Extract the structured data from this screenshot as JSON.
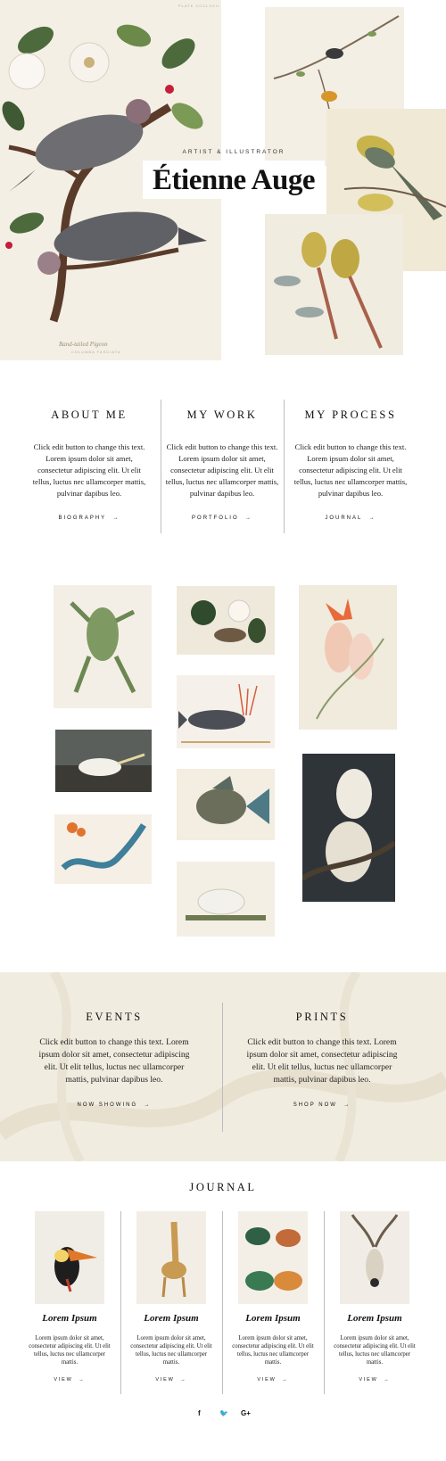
{
  "hero": {
    "kicker": "ARTIST & ILLUSTRATOR",
    "title": "Étienne Auge",
    "plate_corner_label": "PLATE CCCLXVII",
    "plate_caption": "Band-tailed Pigeon",
    "plate_credit_label": "COLUMBA FASCIATA"
  },
  "about": {
    "columns": [
      {
        "heading": "ABOUT ME",
        "text": "Click edit button to change this text. Lorem ipsum dolor sit amet, consectetur adipiscing elit. Ut elit tellus, luctus nec ullamcorper mattis, pulvinar dapibus leo.",
        "link": "BIOGRAPHY",
        "arrow": "→"
      },
      {
        "heading": "MY WORK",
        "text": "Click edit button to change this text. Lorem ipsum dolor sit amet, consectetur adipiscing elit. Ut elit tellus, luctus nec ullamcorper mattis, pulvinar dapibus leo.",
        "link": "PORTFOLIO",
        "arrow": "→"
      },
      {
        "heading": "MY PROCESS",
        "text": "Click edit button to change this text. Lorem ipsum dolor sit amet, consectetur adipiscing elit. Ut elit tellus, luctus nec ullamcorper mattis, pulvinar dapibus leo.",
        "link": "JOURNAL",
        "arrow": "→"
      }
    ]
  },
  "gallery": {
    "items": [
      "frog",
      "magnolia-birds",
      "cockatoo",
      "gannet",
      "coral-fish",
      "snowy-owls",
      "snake-lily",
      "trigger-fish",
      "rabbit"
    ]
  },
  "events": {
    "columns": [
      {
        "heading": "EVENTS",
        "text": "Click edit button to change this text. Lorem ipsum dolor sit amet, consectetur adipiscing elit. Ut elit tellus, luctus nec ullamcorper mattis, pulvinar dapibus leo.",
        "link": "NOW SHOWING",
        "arrow": "→"
      },
      {
        "heading": "PRINTS",
        "text": "Click edit button to change this text. Lorem ipsum dolor sit amet, consectetur adipiscing elit. Ut elit tellus, luctus nec ullamcorper mattis, pulvinar dapibus leo.",
        "link": "SHOP NOW",
        "arrow": "→"
      }
    ]
  },
  "journal": {
    "heading": "JOURNAL",
    "cards": [
      {
        "title": "Lorem Ipsum",
        "text": "Lorem ipsum dolor sit amet, consectetur adipiscing elit. Ut elit tellus, luctus nec ullamcorper mattis.",
        "link": "VIEW",
        "arrow": "→",
        "image": "toucan"
      },
      {
        "title": "Lorem Ipsum",
        "text": "Lorem ipsum dolor sit amet, consectetur adipiscing elit. Ut elit tellus, luctus nec ullamcorper mattis.",
        "link": "VIEW",
        "arrow": "→",
        "image": "giraffe"
      },
      {
        "title": "Lorem Ipsum",
        "text": "Lorem ipsum dolor sit amet, consectetur adipiscing elit. Ut elit tellus, luctus nec ullamcorper mattis.",
        "link": "VIEW",
        "arrow": "→",
        "image": "butterflies"
      },
      {
        "title": "Lorem Ipsum",
        "text": "Lorem ipsum dolor sit amet, consectetur adipiscing elit. Ut elit tellus, luctus nec ullamcorper mattis.",
        "link": "VIEW",
        "arrow": "→",
        "image": "antelope-skull"
      }
    ]
  },
  "social": {
    "facebook": "f",
    "twitter": "🐦",
    "google": "G+"
  },
  "colors": {
    "cream": "#f1ece0",
    "divider": "#bdbdbd",
    "text": "#222222"
  }
}
